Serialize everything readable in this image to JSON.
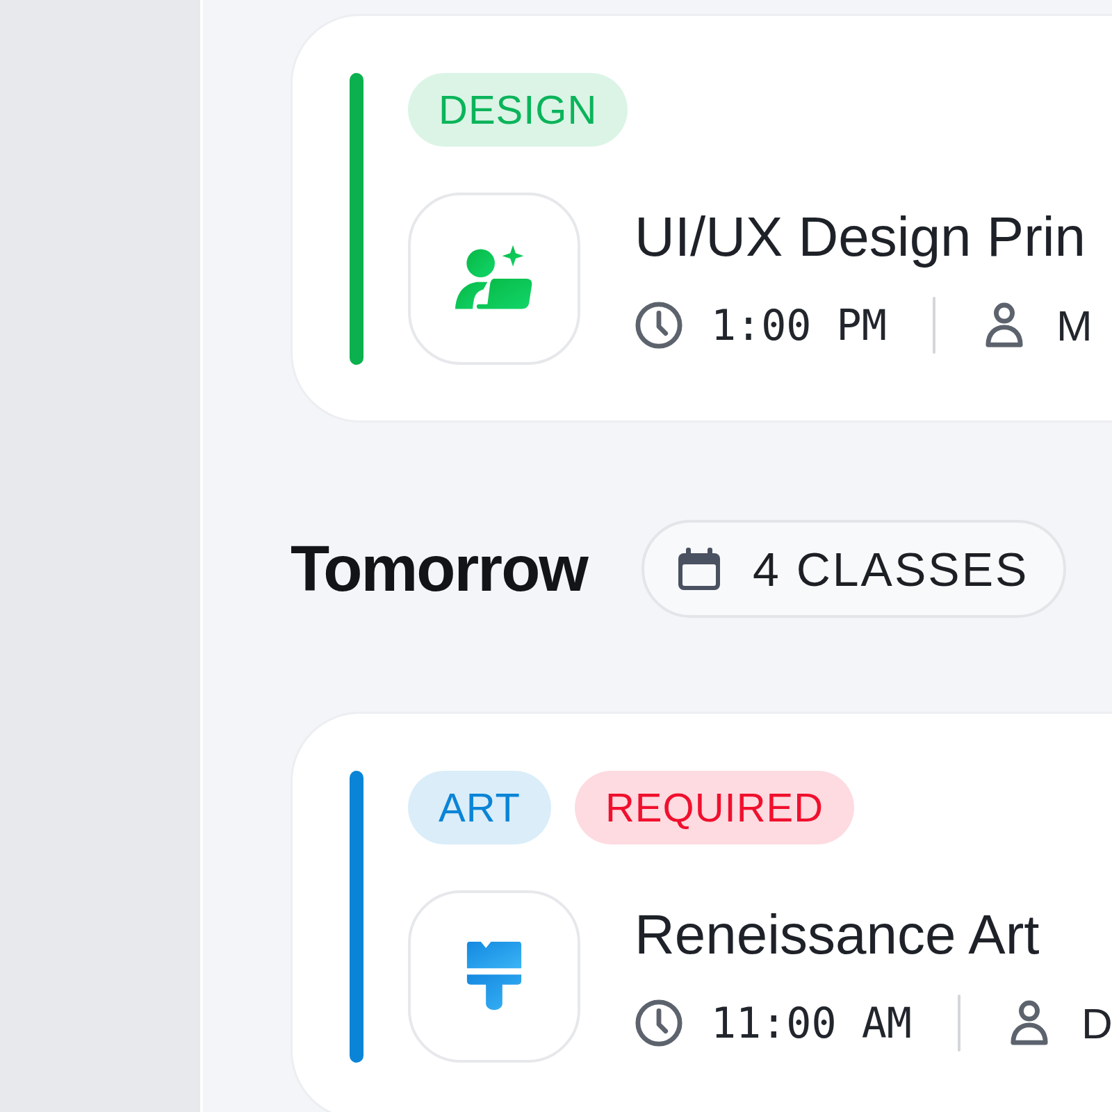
{
  "groups": [
    {
      "classes": [
        {
          "kind": "design",
          "color": "#0bb14e",
          "tags": [
            {
              "label": "DESIGN",
              "color": "#0bb45a"
            }
          ],
          "title": "UI/UX Design Prin",
          "time": "1:00 PM",
          "instructor": "M"
        }
      ]
    },
    {
      "heading": "Tomorrow",
      "count": "4 CLASSES",
      "classes": [
        {
          "kind": "art",
          "color": "#0a84d6",
          "tags": [
            {
              "label": "ART",
              "color": "#0a84d6"
            },
            {
              "label": "REQUIRED",
              "color": "#f0102e"
            }
          ],
          "title": "Reneissance Art",
          "time": "11:00 AM",
          "instructor": "D"
        }
      ]
    }
  ]
}
